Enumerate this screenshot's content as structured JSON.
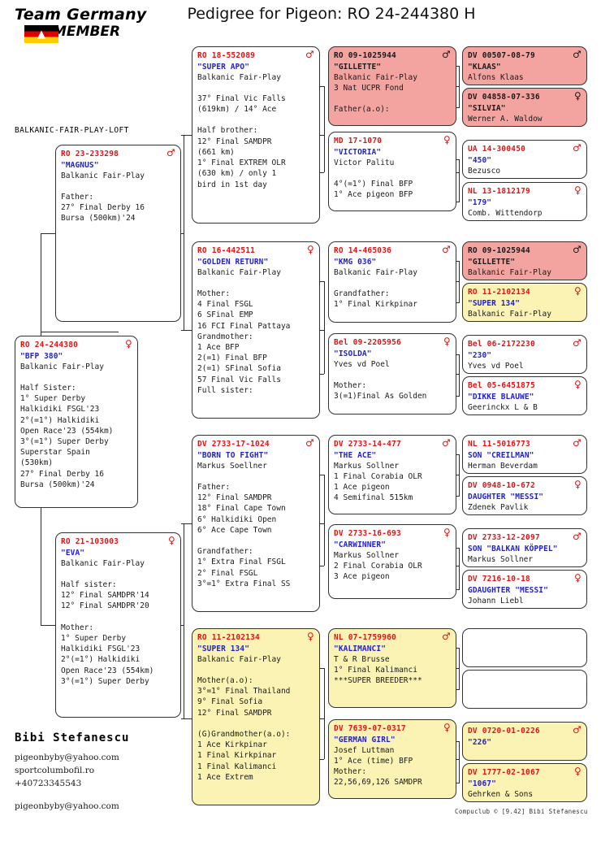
{
  "header": {
    "logo_line1": "Team Germany",
    "logo_line2": "MEMBER",
    "logo_flag_colors": [
      "#000000",
      "#dd0000",
      "#ffcc00"
    ],
    "title": "Pedigree for Pigeon: RO  24-244380 H",
    "loft_name": "BALKANIC-FAIR-PLAY-LOFT"
  },
  "colors": {
    "id_red": "#e11414",
    "name_blue": "#2222cc",
    "pink_box": "#f3a3a0",
    "yellow_box": "#fbf3b4",
    "white_box": "#ffffff",
    "border": "#333333"
  },
  "subject": {
    "id": "RO  24-244380",
    "sex": "female",
    "sex_glyph": "♀",
    "name": "\"BFP 380\"",
    "breeder": "Balkanic Fair-Play",
    "lines": [
      "",
      "Half Sister:",
      "1° Super Derby",
      "Halkidiki FSGL'23",
      "2°(=1°) Halkidiki",
      "Open Race'23 (554km)",
      "3°(=1°) Super Derby",
      "Superstar Spain",
      " (530km)",
      "27° Final Derby 16",
      "Bursa (500km)'24"
    ]
  },
  "gen1": [
    {
      "id": "RO  23-233298",
      "sex_glyph": "♂",
      "name": "\"MAGNUS\"",
      "breeder": "Balkanic Fair-Play",
      "fill": "white",
      "lines": [
        "",
        "Father:",
        "27° Final Derby 16",
        "Bursa (500km)'24"
      ]
    },
    {
      "id": "RO  21-103003",
      "sex_glyph": "♀",
      "name": "\"EVA\"",
      "breeder": "Balkanic Fair-Play",
      "fill": "white",
      "lines": [
        "",
        "Half sister:",
        "12° Final SAMDPR'14",
        "12° Final SAMDPR'20",
        "",
        "Mother:",
        "1° Super Derby",
        "Halkidiki FSGL'23",
        "2°(=1°) Halkidiki",
        "Open Race'23 (554km)",
        "3°(=1°) Super Derby"
      ]
    }
  ],
  "gen2": [
    {
      "id": "RO  18-552089",
      "sex_glyph": "♂",
      "name": "\"SUPER APO\"",
      "breeder": "Balkanic Fair-Play",
      "fill": "white",
      "lines": [
        "",
        "37° Final Vic Falls",
        "(619km) / 14° Ace",
        "",
        "Half brother:",
        "12° Final SAMDPR",
        "(661 km)",
        "1° Final EXTREM OLR",
        "(630 km) / only 1",
        "bird in 1st day"
      ]
    },
    {
      "id": "RO  16-442511",
      "sex_glyph": "♀",
      "name": "\"GOLDEN RETURN\"",
      "breeder": "Balkanic Fair-Play",
      "fill": "white",
      "lines": [
        "",
        "Mother:",
        "4 Final FSGL",
        "6 SFinal EMP",
        "16 FCI Final Pattaya",
        "Grandmother:",
        "1 Ace BFP",
        "2(=1) Final BFP",
        "2(=1) SFinal Sofia",
        "57 Final Vic Falls",
        "Full sister:"
      ]
    },
    {
      "id": "DV  2733-17-1024",
      "sex_glyph": "♂",
      "name": "\"BORN TO FIGHT\"",
      "breeder": "Markus Soellner",
      "fill": "white",
      "lines": [
        "",
        "Father:",
        "12° Final SAMDPR",
        "18° Final Cape Town",
        "6° Halkidiki Open",
        "6° Ace Cape Town",
        "",
        "Grandfather:",
        "1° Extra Final FSGL",
        "2° Final FSGL",
        "3°=1° Extra Final SS"
      ]
    },
    {
      "id": "RO  11-2102134",
      "sex_glyph": "♀",
      "name": "\"SUPER 134\"",
      "breeder": "Balkanic Fair-Play",
      "fill": "yellow",
      "lines": [
        "",
        "Mother(a.o):",
        "3°=1° Final Thailand",
        "9° Final Sofia",
        "12° Final SAMDPR",
        "",
        "(G)Grandmother(a.o):",
        "1 Ace Kirkpinar",
        "1 Final Kirkpinar",
        "1 Final Kalimanci",
        "1 Ace Extrem"
      ]
    }
  ],
  "gen3": [
    {
      "id": "RO  09-1025944",
      "sex_glyph": "♂",
      "name": "\"GILLETTE\"",
      "breeder": "Balkanic Fair-Play",
      "fill": "pink",
      "lines": [
        "3 Nat UCPR Fond",
        "",
        "Father(a.o):"
      ]
    },
    {
      "id": "MD  17-1070",
      "sex_glyph": "♀",
      "name": "\"VICTORIA\"",
      "breeder": "Victor Palitu",
      "fill": "white",
      "lines": [
        "",
        "4°(=1°) Final BFP",
        "1° Ace pigeon BFP"
      ]
    },
    {
      "id": "RO  14-465036",
      "sex_glyph": "♂",
      "name": "\"KMG 036\"",
      "breeder": "Balkanic Fair-Play",
      "fill": "white",
      "lines": [
        "",
        "Grandfather:",
        "1° Final Kirkpinar"
      ]
    },
    {
      "id": "Bel 09-2205956",
      "sex_glyph": "♀",
      "name": "\"ISOLDA\"",
      "breeder": "Yves vd Poel",
      "fill": "white",
      "lines": [
        "",
        "Mother:",
        "3(=1)Final As Golden"
      ]
    },
    {
      "id": "DV  2733-14-477",
      "sex_glyph": "♂",
      "name": "\"THE ACE\"",
      "breeder": "Markus Sollner",
      "fill": "white",
      "lines": [
        "1 Final Corabia OLR",
        "1 Ace pigeon",
        "4 Semifinal 515km"
      ]
    },
    {
      "id": "DV  2733-16-693",
      "sex_glyph": "♀",
      "name": "\"CARWINNER\"",
      "breeder": "Markus Sollner",
      "fill": "white",
      "lines": [
        "2 Final Corabia OLR",
        "3 Ace pigeon"
      ]
    },
    {
      "id": "NL  07-1759960",
      "sex_glyph": "♂",
      "name": "\"KALIMANCI\"",
      "breeder": "T & R Brusse",
      "fill": "yellow",
      "lines": [
        "1° Final Kalimanci",
        "***SUPER BREEDER***"
      ]
    },
    {
      "id": "DV  7639-07-0317",
      "sex_glyph": "♀",
      "name": "\"GERMAN GIRL\"",
      "breeder": "Josef Luttman",
      "fill": "yellow",
      "lines": [
        "1° Ace (time) BFP",
        "Mother:",
        "22,56,69,126 SAMDPR"
      ]
    }
  ],
  "gen4": [
    {
      "id": "DV  00507-08-79",
      "sex_glyph": "♂",
      "name": "\"KLAAS\"",
      "breeder": "Alfons Klaas",
      "fill": "pink"
    },
    {
      "id": "DV  04858-07-336",
      "sex_glyph": "♀",
      "name": "\"SILVIA\"",
      "breeder": "Werner A. Waldow",
      "fill": "pink"
    },
    {
      "id": "UA  14-300450",
      "sex_glyph": "♂",
      "name": "\"450\"",
      "breeder": "Bezusco",
      "fill": "white"
    },
    {
      "id": "NL  13-1812179",
      "sex_glyph": "♀",
      "name": "\"179\"",
      "breeder": "Comb. Wittendorp",
      "fill": "white"
    },
    {
      "id": "RO  09-1025944",
      "sex_glyph": "♂",
      "name": "\"GILLETTE\"",
      "breeder": "Balkanic Fair-Play",
      "fill": "pink"
    },
    {
      "id": "RO  11-2102134",
      "sex_glyph": "♀",
      "name": "\"SUPER 134\"",
      "breeder": "Balkanic Fair-Play",
      "fill": "yellow"
    },
    {
      "id": "Bel 06-2172230",
      "sex_glyph": "♂",
      "name": "\"230\"",
      "breeder": "Yves vd Poel",
      "fill": "white"
    },
    {
      "id": "Bel 05-6451875",
      "sex_glyph": "♀",
      "name": "\"DIKKE BLAUWE\"",
      "breeder": "Geerinckx L & B",
      "fill": "white"
    },
    {
      "id": "NL  11-5016773",
      "sex_glyph": "♂",
      "name": "SON \"CREILMAN\"",
      "breeder": "Herman Beverdam",
      "fill": "white"
    },
    {
      "id": "DV  0948-10-672",
      "sex_glyph": "♀",
      "name": "DAUGHTER \"MESSI\"",
      "breeder": "Zdenek Pavlik",
      "fill": "white"
    },
    {
      "id": "DV  2733-12-2097",
      "sex_glyph": "♂",
      "name": "SON \"BALKAN KÖPPEL\"",
      "breeder": "Markus Sollner",
      "fill": "white"
    },
    {
      "id": "DV  7216-10-18",
      "sex_glyph": "♀",
      "name": "GDAUGHTER \"MESSI\"",
      "breeder": "Johann Liebl",
      "fill": "white"
    },
    {
      "id": "",
      "sex_glyph": "",
      "name": "",
      "breeder": "",
      "fill": "white"
    },
    {
      "id": "",
      "sex_glyph": "",
      "name": "",
      "breeder": "",
      "fill": "white"
    },
    {
      "id": "DV  0720-01-0226",
      "sex_glyph": "♂",
      "name": "\"226\"",
      "breeder": "",
      "fill": "yellow"
    },
    {
      "id": "DV  1777-02-1067",
      "sex_glyph": "♀",
      "name": "\"1067\"",
      "breeder": "Gehrken & Sons",
      "fill": "yellow"
    }
  ],
  "owner": {
    "name": "Bibi Stefanescu",
    "email": "pigeonbyby@yahoo.com",
    "website": "sportcolumbofil.ro",
    "phone": "+40723345543",
    "email2": "pigeonbyby@yahoo.com"
  },
  "credit": "Compuclub © [9.42]  Bibi Stefanescu"
}
